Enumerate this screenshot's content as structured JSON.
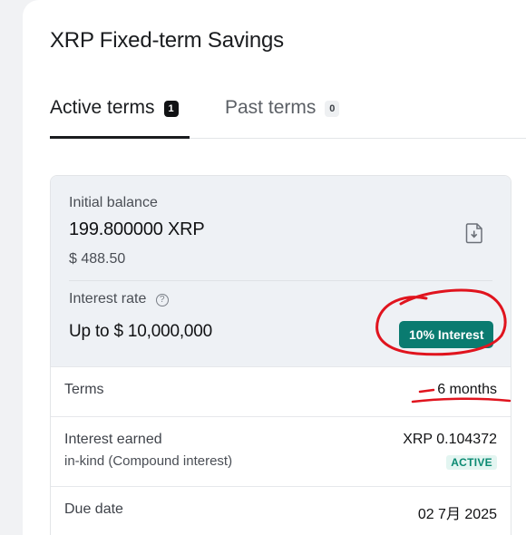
{
  "page": {
    "title": "XRP Fixed-term Savings"
  },
  "tabs": [
    {
      "label": "Active terms",
      "count": "1"
    },
    {
      "label": "Past terms",
      "count": "0"
    }
  ],
  "balance": {
    "label": "Initial balance",
    "amount": "199.800000 XRP",
    "fiat": "$ 488.50"
  },
  "interest_rate": {
    "label": "Interest rate",
    "info_glyph": "?",
    "value": "Up to $ 10,000,000",
    "badge": "10% Interest"
  },
  "details": {
    "terms_label": "Terms",
    "terms_value": "6 months",
    "earned_label": "Interest earned",
    "earned_sub": "in-kind (Compound interest)",
    "earned_value": "XRP 0.104372",
    "earned_status": "ACTIVE",
    "due_label": "Due date",
    "due_value": "02 7月 2025"
  },
  "colors": {
    "accent_teal": "#0a7b70",
    "annotation_red": "#e0141e"
  },
  "icons": {
    "download": "document-download-icon",
    "info": "info-icon"
  }
}
